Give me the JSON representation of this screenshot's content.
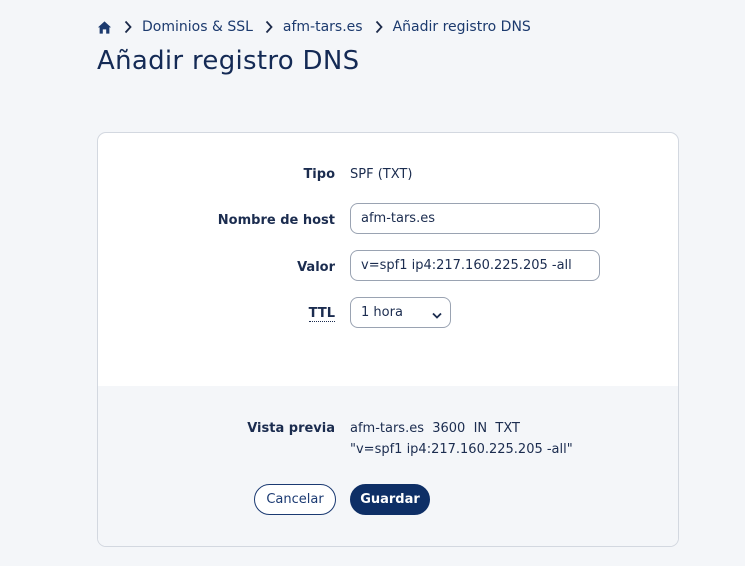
{
  "breadcrumb": {
    "home_icon": "home-icon",
    "items": [
      "Dominios & SSL",
      "afm-tars.es",
      "Añadir registro DNS"
    ]
  },
  "page_title": "Añadir registro DNS",
  "form": {
    "type_label": "Tipo",
    "type_value": "SPF (TXT)",
    "host_label": "Nombre de host",
    "host_value": "afm-tars.es",
    "value_label": "Valor",
    "value_value": "v=spf1 ip4:217.160.225.205 -all",
    "ttl_label": "TTL",
    "ttl_selected": "1 hora"
  },
  "preview": {
    "label": "Vista previa",
    "line1": "afm-tars.es  3600  IN  TXT",
    "line2": "\"v=spf1 ip4:217.160.225.205 -all\""
  },
  "actions": {
    "cancel_label": "Cancelar",
    "save_label": "Guardar"
  },
  "colors": {
    "accent": "#0e2f66",
    "page_bg": "#f4f6f9",
    "text": "#1b2c4f"
  }
}
